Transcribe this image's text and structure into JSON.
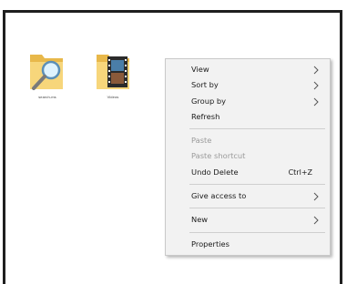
{
  "desktop": {
    "icons": [
      {
        "label": "search-ms",
        "icon": "search-folder-icon"
      },
      {
        "label": "Videos",
        "icon": "videos-folder-icon"
      }
    ]
  },
  "context_menu": {
    "items": [
      {
        "label": "View",
        "has_submenu": true,
        "enabled": true
      },
      {
        "label": "Sort by",
        "has_submenu": true,
        "enabled": true
      },
      {
        "label": "Group by",
        "has_submenu": true,
        "enabled": true
      },
      {
        "label": "Refresh",
        "has_submenu": false,
        "enabled": true
      },
      {
        "label": "Paste",
        "has_submenu": false,
        "enabled": false
      },
      {
        "label": "Paste shortcut",
        "has_submenu": false,
        "enabled": false
      },
      {
        "label": "Undo Delete",
        "shortcut": "Ctrl+Z",
        "enabled": true
      },
      {
        "label": "Give access to",
        "has_submenu": true,
        "enabled": true
      },
      {
        "label": "New",
        "has_submenu": true,
        "enabled": true
      },
      {
        "label": "Properties",
        "has_submenu": false,
        "enabled": true
      }
    ]
  }
}
